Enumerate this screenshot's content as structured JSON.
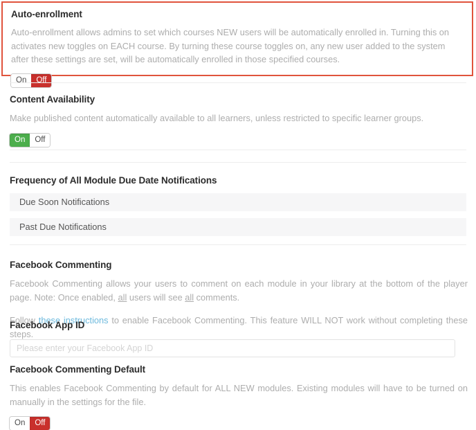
{
  "auto_enrollment": {
    "heading": "Auto-enrollment",
    "description": "Auto-enrollment allows admins to set which courses NEW users will be automatically enrolled in. Turning this on activates new toggles on EACH course. By turning these course toggles on, any new user added to the system after these settings are set, will be automatically enrolled in those specified courses.",
    "toggle": {
      "on_label": "On",
      "off_label": "Off",
      "state": "Off"
    },
    "highlight_color": "#e0533c"
  },
  "content_availability": {
    "heading": "Content Availability",
    "description": "Make published content automatically available to all learners, unless restricted to specific learner groups.",
    "toggle": {
      "on_label": "On",
      "off_label": "Off",
      "state": "On"
    }
  },
  "notifications": {
    "heading": "Frequency of All Module Due Date Notifications",
    "rows": [
      {
        "label": "Due Soon Notifications"
      },
      {
        "label": "Past Due Notifications"
      }
    ]
  },
  "facebook_commenting": {
    "heading": "Facebook Commenting",
    "description_part1": "Facebook Commenting allows your users to comment on each module in your library at the bottom of the player page. Note: Once enabled, ",
    "description_emph1": "all",
    "description_part2": " users will see ",
    "description_emph2": "all",
    "description_part3": " comments.",
    "follow_prefix": "Follow ",
    "link_text": "these instructions",
    "follow_suffix": " to enable Facebook Commenting. This feature WILL NOT work without completing these steps.",
    "link_color": "#6cb9dd"
  },
  "facebook_app_id": {
    "label": "Facebook App ID",
    "placeholder": "Please enter your Facebook App ID",
    "value": ""
  },
  "facebook_commenting_default": {
    "heading": "Facebook Commenting Default",
    "description": "This enables Facebook Commenting by default for ALL NEW modules. Existing modules will have to be turned on manually in the settings for the file.",
    "toggle": {
      "on_label": "On",
      "off_label": "Off",
      "state": "Off"
    }
  },
  "theme": {
    "toggle_on_color": "#4cae4c",
    "toggle_off_color": "#c9302c",
    "divider_color": "#ededed",
    "row_bg": "#f6f6f7",
    "body_text_color": "#adadad",
    "heading_text_color": "#2c2c2c"
  }
}
